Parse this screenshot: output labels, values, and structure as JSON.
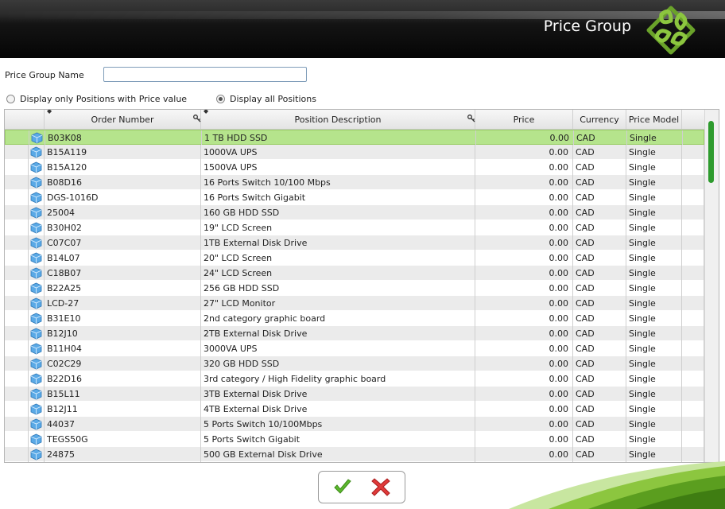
{
  "header": {
    "title": "Price Group"
  },
  "form": {
    "name_label": "Price Group Name",
    "name_value": "",
    "radio_option_1": "Display only Positions with Price value",
    "radio_option_2": "Display all Positions",
    "selected_option": 2
  },
  "table": {
    "columns": [
      "Order Number",
      "Position Description",
      "Price",
      "Currency",
      "Price Model"
    ],
    "rows": [
      [
        "B03K08",
        "1 TB HDD SSD",
        "0.00",
        "CAD",
        "Single"
      ],
      [
        "B15A119",
        "1000VA UPS",
        "0.00",
        "CAD",
        "Single"
      ],
      [
        "B15A120",
        "1500VA UPS",
        "0.00",
        "CAD",
        "Single"
      ],
      [
        "B08D16",
        "16 Ports Switch 10/100 Mbps",
        "0.00",
        "CAD",
        "Single"
      ],
      [
        "DGS-1016D",
        "16 Ports Switch Gigabit",
        "0.00",
        "CAD",
        "Single"
      ],
      [
        "25004",
        "160 GB HDD SSD",
        "0.00",
        "CAD",
        "Single"
      ],
      [
        "B30H02",
        "19\" LCD Screen",
        "0.00",
        "CAD",
        "Single"
      ],
      [
        "C07C07",
        "1TB External Disk Drive",
        "0.00",
        "CAD",
        "Single"
      ],
      [
        "B14L07",
        "20\" LCD Screen",
        "0.00",
        "CAD",
        "Single"
      ],
      [
        "C18B07",
        "24\" LCD Screen",
        "0.00",
        "CAD",
        "Single"
      ],
      [
        "B22A25",
        "256 GB HDD SSD",
        "0.00",
        "CAD",
        "Single"
      ],
      [
        "LCD-27",
        "27\" LCD Monitor",
        "0.00",
        "CAD",
        "Single"
      ],
      [
        "B31E10",
        "2nd category graphic board",
        "0.00",
        "CAD",
        "Single"
      ],
      [
        "B12J10",
        "2TB External Disk Drive",
        "0.00",
        "CAD",
        "Single"
      ],
      [
        "B11H04",
        "3000VA UPS",
        "0.00",
        "CAD",
        "Single"
      ],
      [
        "C02C29",
        "320 GB HDD SSD",
        "0.00",
        "CAD",
        "Single"
      ],
      [
        "B22D16",
        "3rd category / High Fidelity graphic board",
        "0.00",
        "CAD",
        "Single"
      ],
      [
        "B15L11",
        "3TB External Disk Drive",
        "0.00",
        "CAD",
        "Single"
      ],
      [
        "B12J11",
        "4TB External Disk Drive",
        "0.00",
        "CAD",
        "Single"
      ],
      [
        "44037",
        "5 Ports Switch 10/100Mbps",
        "0.00",
        "CAD",
        "Single"
      ],
      [
        "TEGS50G",
        "5 Ports Switch Gigabit",
        "0.00",
        "CAD",
        "Single"
      ],
      [
        "24875",
        "500 GB External Disk Drive",
        "0.00",
        "CAD",
        "Single"
      ]
    ],
    "selected_row": 0
  },
  "actions": {
    "confirm_icon": "checkmark-icon",
    "cancel_icon": "x-icon"
  },
  "colors": {
    "selected_row": "#b5e48c",
    "accent_green": "#8cc63f",
    "header_bg": "#111111"
  }
}
